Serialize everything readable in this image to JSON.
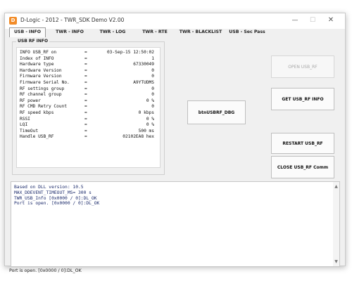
{
  "window": {
    "title": "D-Logic - 2012  - TWR_SDK Demo V2.00",
    "icon_letter": "D",
    "controls": {
      "minimize": "—",
      "maximize": "☐",
      "close": "✕"
    }
  },
  "tabs": [
    {
      "label": "USB - INFO",
      "active": true
    },
    {
      "label": "TWR - INFO",
      "active": false
    },
    {
      "label": "TWR - LOG",
      "active": false
    },
    {
      "label": "TWR - RTE",
      "active": false
    },
    {
      "label": "TWR - BLACKLIST",
      "active": false
    },
    {
      "label": "USB - Sec Pass",
      "active": false
    }
  ],
  "usb_rf_info": {
    "group_title": "USB RF INFO",
    "rows": [
      {
        "key": "INFO USB_RF on",
        "eq": "=",
        "value": "03-Sep-15 12:50:02"
      },
      {
        "key": "Index of INFO",
        "eq": "=",
        "value": "1"
      },
      {
        "key": "Hardware type",
        "eq": "=",
        "value": "67330049"
      },
      {
        "key": "Hardware Version",
        "eq": "=",
        "value": "0"
      },
      {
        "key": "Firmware Version",
        "eq": "=",
        "value": "0"
      },
      {
        "key": "Firmware Serial No.",
        "eq": "=",
        "value": "A9YTUDMS"
      },
      {
        "key": "RF settings group",
        "eq": "=",
        "value": "0"
      },
      {
        "key": "RF channel group",
        "eq": "=",
        "value": "0"
      },
      {
        "key": "RF power",
        "eq": "=",
        "value": "0 %"
      },
      {
        "key": "RF CMD Retry Count",
        "eq": "=",
        "value": "0"
      },
      {
        "key": "RF speed kbps",
        "eq": "=",
        "value": "0 kbps"
      },
      {
        "key": "RSSI",
        "eq": "=",
        "value": "0 %"
      },
      {
        "key": "LQI",
        "eq": "=",
        "value": "0 %"
      },
      {
        "key": "TimeOut",
        "eq": "=",
        "value": "500 ms"
      },
      {
        "key": "Handle USB_RF",
        "eq": "=",
        "value": "02102EA8 hex"
      }
    ]
  },
  "buttons": {
    "dbg": "btnUSBRF_DBG",
    "open": "OPEN USB_RF",
    "get_info": "GET USB_RF INFO",
    "restart": "RESTART USB_RF",
    "close_comm": "CLOSE USB_RF Comm"
  },
  "log": {
    "lines": [
      "Based on DLL version: 10.5",
      "MAX_DDEVENT_TIMEOUT_MS= 300 s",
      "TWR_USB_Info [0x0000 / 0]:DL_OK",
      "Port is open. [0x0000 / 0]:DL_OK"
    ]
  },
  "status": {
    "text": "Port is open. [0x0000 / 0]:DL_OK"
  }
}
